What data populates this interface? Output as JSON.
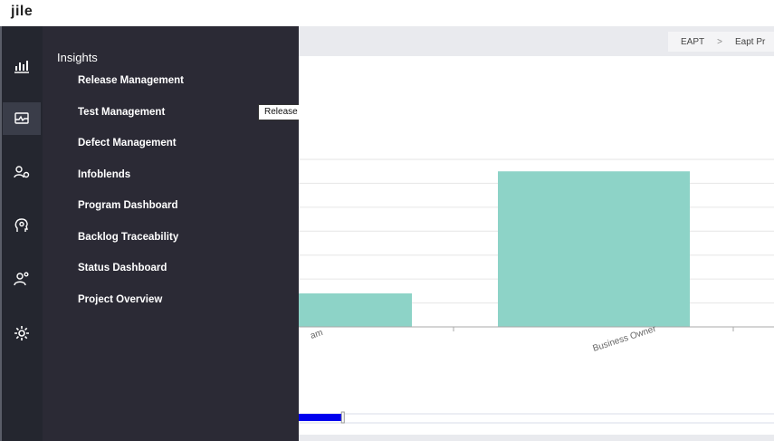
{
  "app": {
    "logo": "jile"
  },
  "rail": {
    "icons": [
      "bar-chart-icon",
      "dashboard-icon",
      "users-settings-icon",
      "lightbulb-head-icon",
      "team-icon",
      "settings-gear-icon"
    ],
    "active_index": 1
  },
  "flyout": {
    "title": "Insights",
    "items": [
      "Release Management",
      "Test Management",
      "Defect Management",
      "Infoblends",
      "Program Dashboard",
      "Backlog Traceability",
      "Status Dashboard",
      "Project Overview"
    ]
  },
  "tooltip": {
    "text": "Release Management"
  },
  "breadcrumb": {
    "items": [
      "EAPT",
      "Eapt Pr"
    ],
    "separator": ">"
  },
  "chart_data": {
    "type": "bar",
    "categories": [
      "am",
      "Business Owner"
    ],
    "values": [
      14,
      65
    ],
    "ylim": [
      0,
      70
    ],
    "color": "#8dd3c7",
    "grid": true,
    "scrollbar_fraction": 0.1
  }
}
